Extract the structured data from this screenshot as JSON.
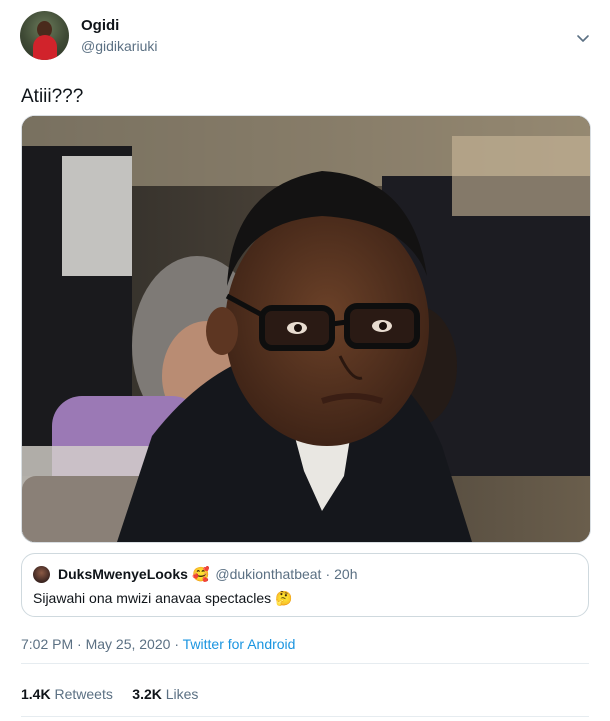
{
  "tweet": {
    "author": {
      "name": "Ogidi",
      "handle": "@gidikariuki"
    },
    "text": "Atiii???",
    "timestamp": "7:02 PM · May 25, 2020",
    "source": "Twitter for Android",
    "stats": {
      "retweets_count": "1.4K",
      "retweets_label": "Retweets",
      "likes_count": "3.2K",
      "likes_label": "Likes"
    }
  },
  "quoted_tweet": {
    "name": "DuksMwenyeLooks",
    "emoji": "🥰",
    "handle": "@dukionthatbeat",
    "separator": "·",
    "time": "20h",
    "text": "Sijawahi ona mwizi anavaa spectacles 🤔"
  },
  "icons": {
    "menu": "chevron-down-icon"
  },
  "colors": {
    "link": "#1b95e0",
    "secondary_text": "#5b7083",
    "border": "#cfd9de"
  }
}
